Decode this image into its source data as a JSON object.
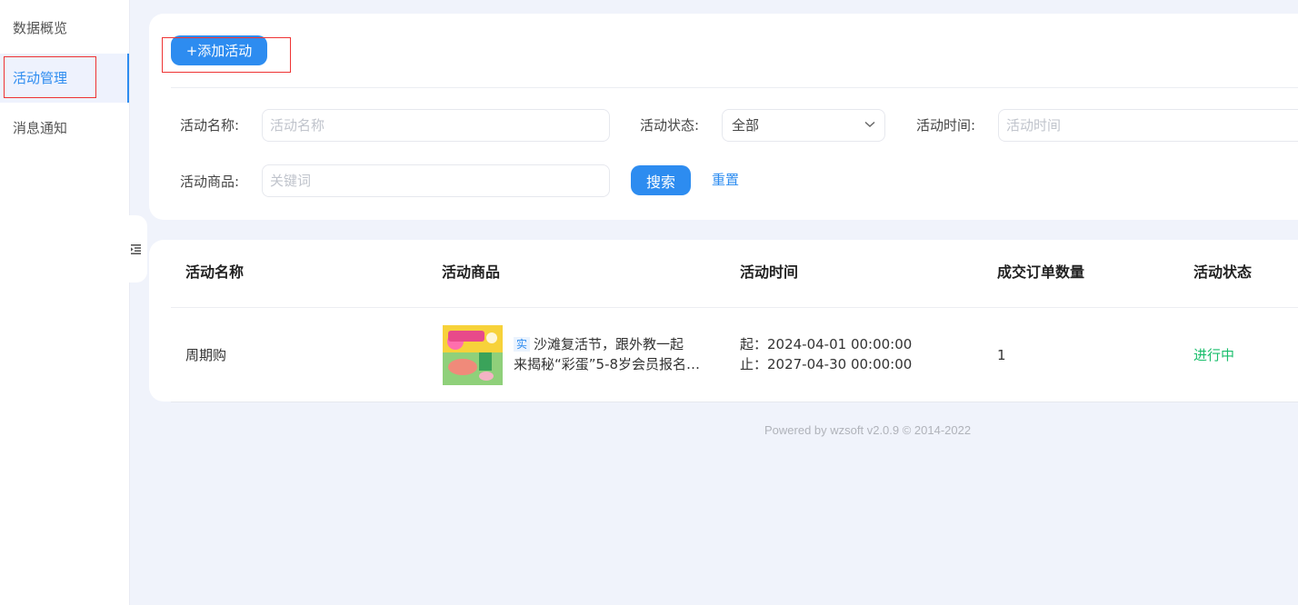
{
  "sidebar": {
    "items": [
      {
        "label": "数据概览"
      },
      {
        "label": "活动管理"
      },
      {
        "label": "消息通知"
      }
    ]
  },
  "toolbar": {
    "add_label": "+添加活动"
  },
  "filters": {
    "name_label": "活动名称:",
    "name_placeholder": "活动名称",
    "status_label": "活动状态:",
    "status_value": "全部",
    "time_label": "活动时间:",
    "time_placeholder": "活动时间",
    "product_label": "活动商品:",
    "product_placeholder": "关键词",
    "search_label": "搜索",
    "reset_label": "重置"
  },
  "table": {
    "headers": [
      "活动名称",
      "活动商品",
      "活动时间",
      "成交订单数量",
      "活动状态"
    ],
    "rows": [
      {
        "name": "周期购",
        "product_tag": "实",
        "product_line1": "沙滩复活节，跟外教一起",
        "product_line2": "来揭秘“彩蛋”5-8岁会员报名…",
        "start": "起：2024-04-01 00:00:00",
        "end": "止：2027-04-30 00:00:00",
        "orders": "1",
        "status": "进行中"
      }
    ]
  },
  "footer": {
    "text": "Powered by wzsoft v2.0.9 © 2014-2022"
  },
  "colors": {
    "accent": "#2d8cf0",
    "status_active": "#19be6b",
    "highlight_box": "#ee3333"
  },
  "icons": {
    "collapse": "collapse-menu-icon",
    "dropdown": "chevron-down-icon"
  }
}
